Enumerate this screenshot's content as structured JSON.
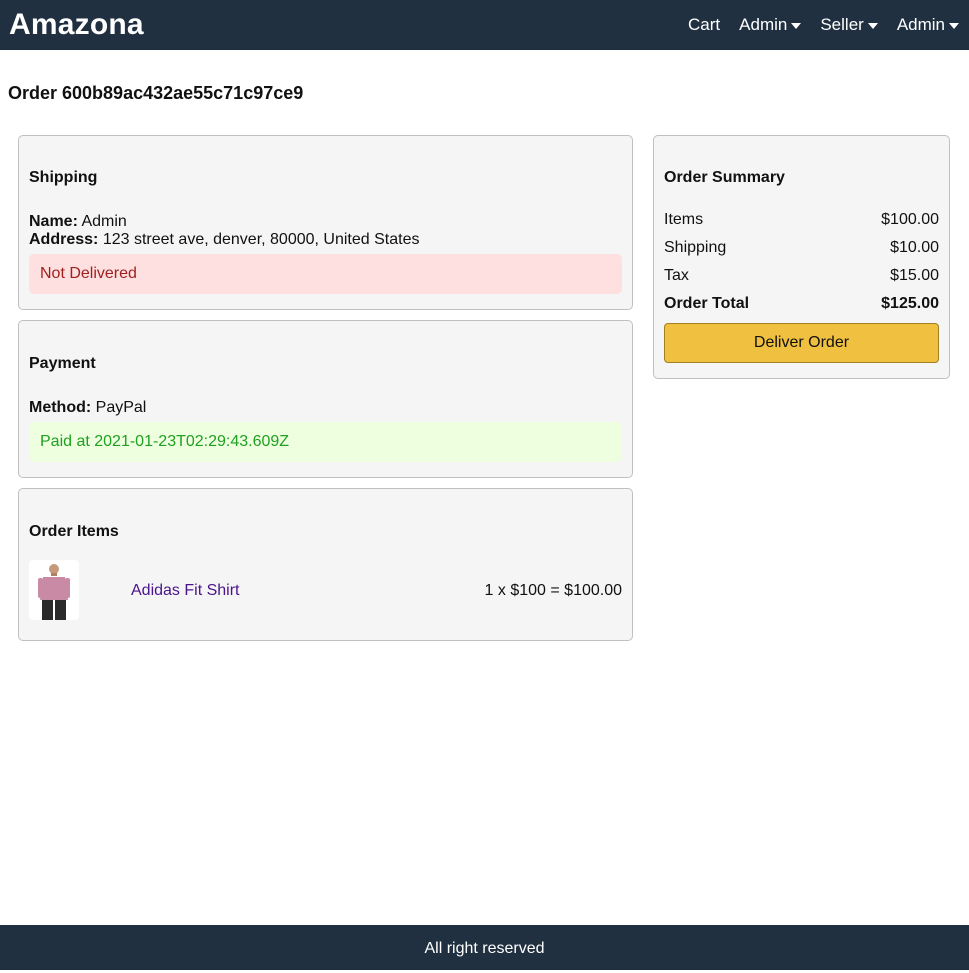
{
  "header": {
    "brand": "Amazona",
    "nav": {
      "cart": "Cart",
      "admin_user": "Admin",
      "seller": "Seller",
      "admin_menu": "Admin"
    }
  },
  "order": {
    "title": "Order 600b89ac432ae55c71c97ce9"
  },
  "shipping": {
    "heading": "Shipping",
    "name_label": "Name:",
    "name_value": "Admin",
    "address_label": "Address:",
    "address_value": "123 street ave, denver, 80000, United States",
    "status": "Not Delivered"
  },
  "payment": {
    "heading": "Payment",
    "method_label": "Method:",
    "method_value": "PayPal",
    "status": "Paid at 2021-01-23T02:29:43.609Z"
  },
  "order_items": {
    "heading": "Order Items",
    "items": [
      {
        "name": "Adidas Fit Shirt",
        "price_line": "1 x $100 = $100.00"
      }
    ]
  },
  "summary": {
    "heading": "Order Summary",
    "rows": [
      {
        "label": "Items",
        "value": "$100.00"
      },
      {
        "label": "Shipping",
        "value": "$10.00"
      },
      {
        "label": "Tax",
        "value": "$15.00"
      },
      {
        "label": "Order Total",
        "value": "$125.00"
      }
    ],
    "deliver_button": "Deliver Order"
  },
  "footer": {
    "text": "All right reserved"
  },
  "colors": {
    "header_bg": "#203040",
    "button_bg": "#f0c040",
    "danger_bg": "#ffe0e0",
    "success_bg": "#eeffe0",
    "link": "#4a148c"
  }
}
